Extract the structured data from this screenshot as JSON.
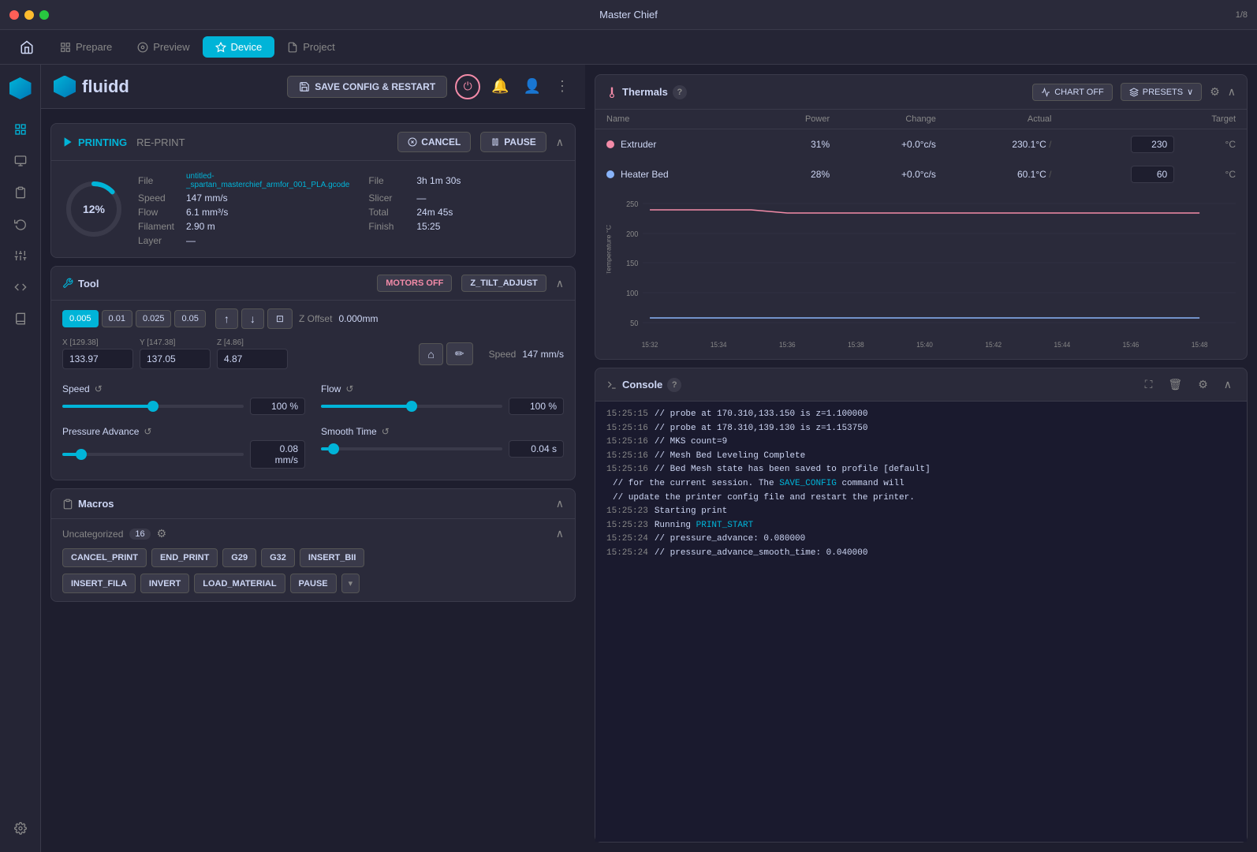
{
  "window": {
    "title": "Master Chief",
    "counter": "1/8"
  },
  "navbar": {
    "tabs": [
      {
        "label": "Prepare",
        "icon": "⊞",
        "active": false
      },
      {
        "label": "Preview",
        "icon": "◎",
        "active": false
      },
      {
        "label": "Device",
        "icon": "⬡",
        "active": true
      },
      {
        "label": "Project",
        "icon": "☰",
        "active": false
      }
    ]
  },
  "app_header": {
    "logo": "fluidd",
    "save_config_btn": "SAVE CONFIG & RESTART"
  },
  "sidebar": {
    "icons": [
      "⌂",
      "⊞",
      "◉",
      "☰",
      "⏱",
      "≡",
      "{}",
      "☰",
      "⚙"
    ]
  },
  "printing_card": {
    "printing_label": "PRINTING",
    "reprint_label": "RE-PRINT",
    "cancel_btn": "CANCEL",
    "pause_btn": "PAUSE",
    "progress_pct": "12%",
    "file_label": "File",
    "file_value": "untitled-_spartan_masterchief_armfor_001_PLA.gcode",
    "speed_label": "Speed",
    "speed_value": "147 mm/s",
    "file2_label": "File",
    "file2_value": "3h 1m 30s",
    "flow_label": "Flow",
    "flow_value": "6.1 mm³/s",
    "slicer_label": "Slicer",
    "slicer_value": "—",
    "filament_label": "Filament",
    "filament_value": "2.90 m",
    "total_label": "Total",
    "total_value": "24m 45s",
    "layer_label": "Layer",
    "layer_value": "—",
    "finish_label": "Finish",
    "finish_value": "15:25"
  },
  "tool_card": {
    "title": "Tool",
    "motors_off_btn": "MOTORS OFF",
    "z_tilt_btn": "Z_TILT_ADJUST",
    "presets": [
      "0.005",
      "0.01",
      "0.025",
      "0.05"
    ],
    "z_offset_label": "Z Offset",
    "z_offset_value": "0.000mm",
    "x_pos_label": "X [129.38]",
    "x_pos_value": "133.97",
    "y_pos_label": "Y [147.38]",
    "y_pos_value": "137.05",
    "z_pos_label": "Z [4.86]",
    "z_pos_value": "4.87",
    "speed_label": "Speed",
    "speed_value": "147 mm/s",
    "speed_slider_label": "Speed",
    "speed_pct": "100 %",
    "flow_slider_label": "Flow",
    "flow_pct": "100 %",
    "pressure_advance_label": "Pressure\nAdvance",
    "pressure_advance_value": "0.08 mm/s",
    "smooth_time_label": "Smooth Time",
    "smooth_time_value": "0.04 s"
  },
  "macros_card": {
    "title": "Macros",
    "uncategorized_label": "Uncategorized",
    "badge_count": "16",
    "btns_row1": [
      "CANCEL_PRINT",
      "END_PRINT",
      "G29",
      "G32",
      "INSERT_BII"
    ],
    "btns_row2": [
      "INSERT_FILA",
      "INVERT",
      "LOAD_MATERIAL",
      "PAUSE"
    ]
  },
  "thermals_card": {
    "title": "Thermals",
    "chart_off_btn": "CHART OFF",
    "presets_btn": "PRESETS",
    "columns": [
      "Name",
      "Power",
      "Change",
      "Actual",
      "Target"
    ],
    "temp_label": "Temperature °C",
    "rows": [
      {
        "name": "Extruder",
        "type": "red",
        "power": "31%",
        "change": "+0.0°c/s",
        "actual": "230.1°C",
        "target": "230"
      },
      {
        "name": "Heater Bed",
        "type": "blue",
        "power": "28%",
        "change": "+0.0°c/s",
        "actual": "60.1°C",
        "target": "60"
      }
    ],
    "chart": {
      "y_label": "Temperature °C",
      "y_ticks": [
        "250",
        "200",
        "150",
        "100",
        "50"
      ],
      "x_ticks": [
        "15:32",
        "15:34",
        "15:36",
        "15:38",
        "15:40",
        "15:42",
        "15:44",
        "15:46",
        "15:48"
      ]
    }
  },
  "console_card": {
    "title": "Console",
    "lines": [
      {
        "time": "15:25:15",
        "text": "// probe at 170.310,133.150 is z=1.100000"
      },
      {
        "time": "15:25:16",
        "text": "// probe at 178.310,139.130 is z=1.153750"
      },
      {
        "time": "15:25:16",
        "text": "// MKS count=9"
      },
      {
        "time": "15:25:16",
        "text": "// Mesh Bed Leveling Complete"
      },
      {
        "time": "15:25:16",
        "text": "// Bed Mesh state has been saved to profile [default]"
      },
      {
        "time": "",
        "text": "// for the current session. The SAVE_CONFIG command will"
      },
      {
        "time": "",
        "text": "// update the printer config file and restart the printer."
      },
      {
        "time": "15:25:23",
        "text": "Starting print"
      },
      {
        "time": "15:25:23",
        "text": "Running PRINT_START"
      },
      {
        "time": "15:25:24",
        "text": "// pressure_advance: 0.080000"
      },
      {
        "time": "15:25:24",
        "text": "// pressure_advance_smooth_time: 0.040000"
      }
    ],
    "save_config_link": "SAVE_CONFIG",
    "print_start_link": "PRINT_START"
  }
}
